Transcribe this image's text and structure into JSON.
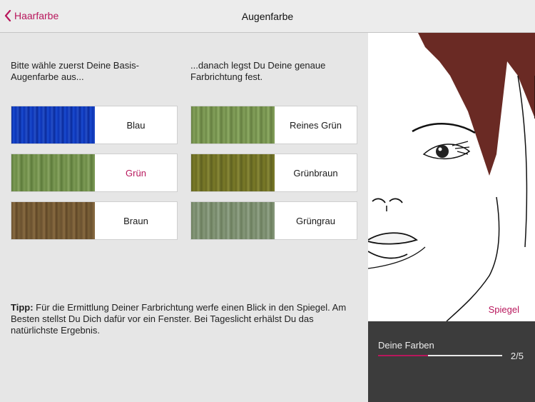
{
  "navbar": {
    "back_label": "Haarfarbe",
    "title": "Augenfarbe"
  },
  "colors": {
    "accent": "#b8175c",
    "panel": "#3c3c3c",
    "hair": "#6a2a24"
  },
  "left": {
    "base_instruction": "Bitte wähle zuerst Deine Basis-Augenfarbe aus...",
    "detail_instruction": "...danach legst Du Deine genaue Farbrichtung fest.",
    "base_options": [
      {
        "label": "Blau",
        "selected": false
      },
      {
        "label": "Grün",
        "selected": true
      },
      {
        "label": "Braun",
        "selected": false
      }
    ],
    "detail_options": [
      {
        "label": "Reines Grün",
        "selected": false
      },
      {
        "label": "Grünbraun",
        "selected": false
      },
      {
        "label": "Grüngrau",
        "selected": false
      }
    ],
    "tip_title": "Tipp:",
    "tip_text": "Für die Ermittlung Deiner Farbrichtung werfe einen Blick in den Spiegel. Am Besten stellst Du Dich dafür vor ein Fenster. Bei Tageslicht erhälst Du das natürlichste Ergebnis."
  },
  "right": {
    "mirror_label": "Spiegel",
    "colors_label": "Deine Farben",
    "progress_fraction": 0.4,
    "step_label": "2/5"
  }
}
